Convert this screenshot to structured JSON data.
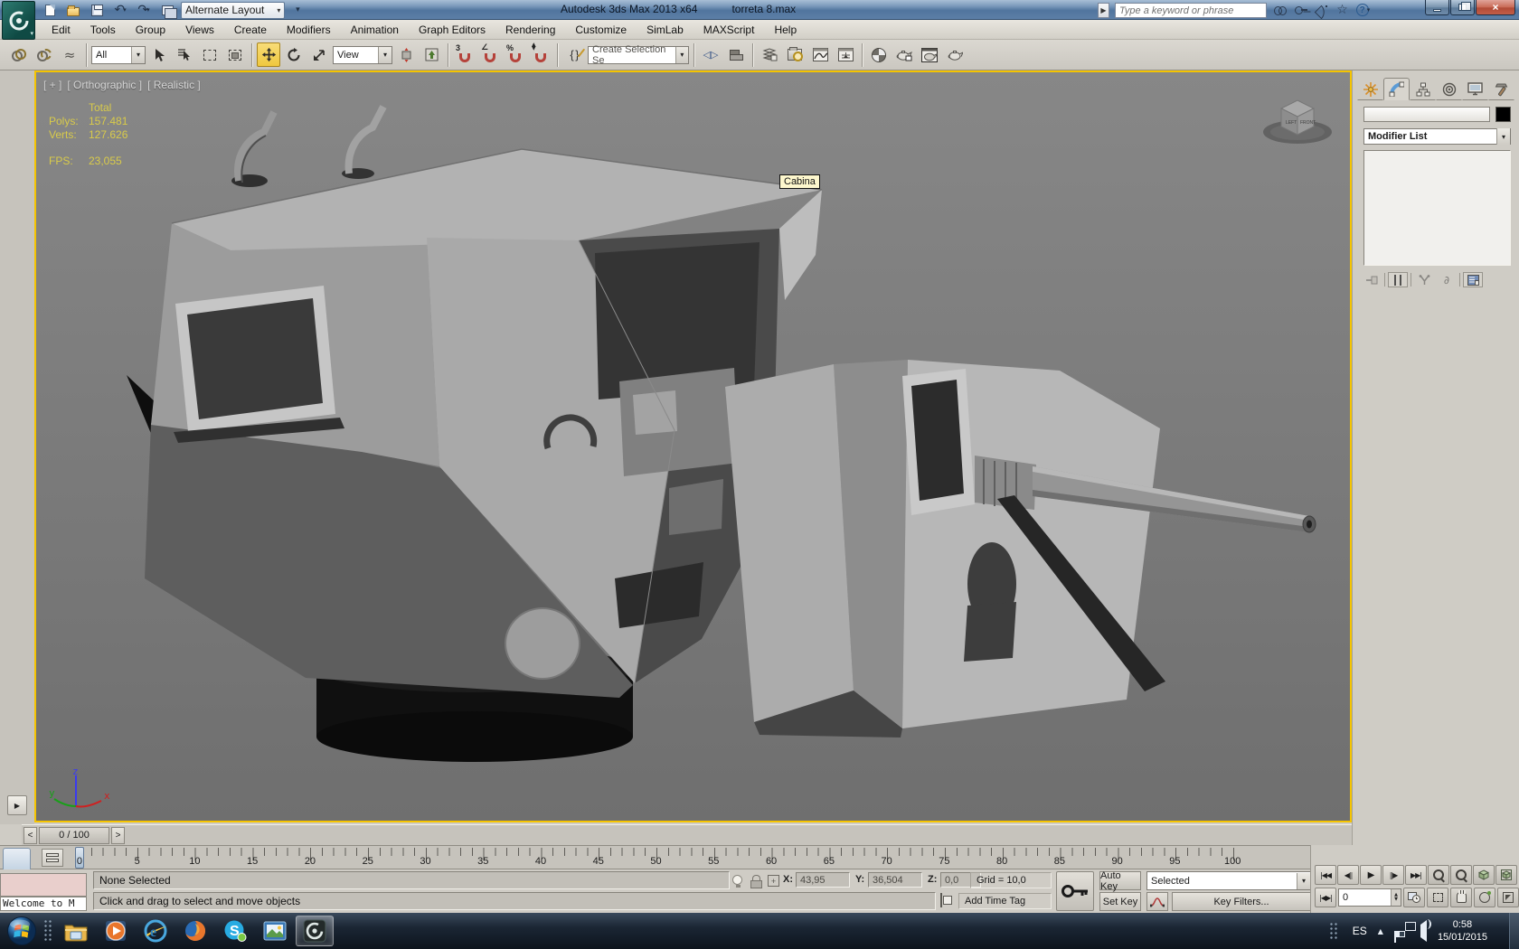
{
  "window": {
    "title": "Autodesk 3ds Max  2013 x64",
    "filename": "torreta 8.max",
    "workspace": "Alternate Layout",
    "search_placeholder": "Type a keyword or phrase"
  },
  "menus": [
    "Edit",
    "Tools",
    "Group",
    "Views",
    "Create",
    "Modifiers",
    "Animation",
    "Graph Editors",
    "Rendering",
    "Customize",
    "SimLab",
    "MAXScript",
    "Help"
  ],
  "toolbar": {
    "selection_filter": "All",
    "reference_coordsys": "View",
    "selection_set_placeholder": "Create Selection Se",
    "snap_label": "3",
    "percent_label": "%",
    "angle_label": "∠"
  },
  "viewport": {
    "label_general": "[ + ]",
    "label_pov": "[ Orthographic ]",
    "label_shading": "[ Realistic ]",
    "stats": {
      "total_header": "Total",
      "polys_label": "Polys:",
      "polys_value": "157.481",
      "verts_label": "Verts:",
      "verts_value": "127.626",
      "fps_label": "FPS:",
      "fps_value": "23,055"
    },
    "object_tooltip": "Cabina",
    "axis_x": "x",
    "axis_y": "y",
    "axis_z": "z",
    "viewcube_left": "LEFT",
    "viewcube_front": "FRONT"
  },
  "command_panel": {
    "modifier_list": "Modifier List"
  },
  "timeline": {
    "time_slider": "0 / 100",
    "prev_label": "<",
    "next_label": ">",
    "ruler_labels": [
      "0",
      "5",
      "10",
      "15",
      "20",
      "25",
      "30",
      "35",
      "40",
      "45",
      "50",
      "55",
      "60",
      "65",
      "70",
      "75",
      "80",
      "85",
      "90",
      "95",
      "100"
    ]
  },
  "status": {
    "listener_line": "Welcome to M",
    "selection_status": "None Selected",
    "prompt": "Click and drag to select and move objects",
    "coord_x_label": "X:",
    "coord_x": "43,95",
    "coord_y_label": "Y:",
    "coord_y": "36,504",
    "coord_z_label": "Z:",
    "coord_z": "0,0",
    "grid": "Grid = 10,0",
    "add_time_tag": "Add Time Tag",
    "auto_key": "Auto Key",
    "set_key": "Set Key",
    "key_mode": "Selected",
    "key_filters": "Key Filters...",
    "current_frame": "0"
  },
  "taskbar": {
    "language": "ES",
    "time": "0:58",
    "date": "15/01/2015"
  },
  "colors": {
    "viewport_border": "#f5c400",
    "stats_text": "#d9cb4a",
    "move_tool_active": "#efc83e",
    "titlebar_blue": "#51759e",
    "taskbar_dark": "#0d141d"
  }
}
